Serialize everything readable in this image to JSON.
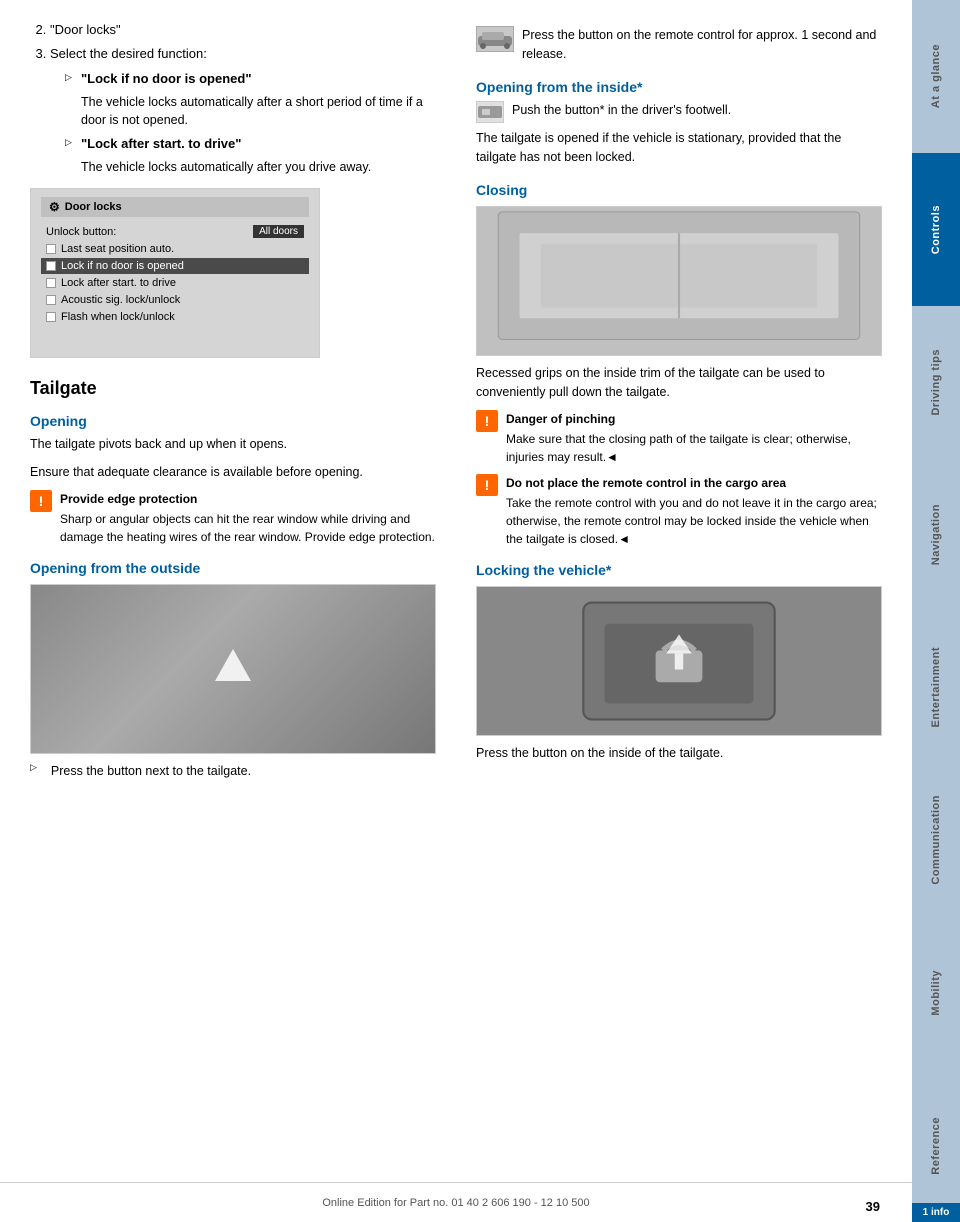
{
  "page": {
    "number": "39",
    "footer_text": "Online Edition for Part no. 01 40 2 606 190 - 12 10 500",
    "info_badge": "1 info"
  },
  "sidebar": {
    "tabs": [
      {
        "id": "at-a-glance",
        "label": "At a glance",
        "active": false
      },
      {
        "id": "controls",
        "label": "Controls",
        "active": true
      },
      {
        "id": "driving-tips",
        "label": "Driving tips",
        "active": false
      },
      {
        "id": "navigation",
        "label": "Navigation",
        "active": false
      },
      {
        "id": "entertainment",
        "label": "Entertainment",
        "active": false
      },
      {
        "id": "communication",
        "label": "Communication",
        "active": false
      },
      {
        "id": "mobility",
        "label": "Mobility",
        "active": false
      },
      {
        "id": "reference",
        "label": "Reference",
        "active": false
      }
    ]
  },
  "left_column": {
    "list_items": [
      {
        "number": "2",
        "text": "\"Door locks\""
      },
      {
        "number": "3",
        "text": "Select the desired function:",
        "subitems": [
          {
            "label": "\"Lock if no door is opened\"",
            "detail": "The vehicle locks automatically after a short period of time if a door is not opened."
          },
          {
            "label": "\"Lock after start. to drive\"",
            "detail": "The vehicle locks automatically after you drive away."
          }
        ]
      }
    ],
    "door_locks_ui": {
      "title": "Door locks",
      "unlock_label": "Unlock button:",
      "unlock_value": "All doors",
      "rows": [
        {
          "type": "checkbox",
          "label": "Last seat position auto.",
          "checked": false,
          "highlighted": false
        },
        {
          "type": "checkbox",
          "label": "Lock if no door is opened",
          "checked": false,
          "highlighted": true
        },
        {
          "type": "checkbox",
          "label": "Lock after start. to drive",
          "checked": false,
          "highlighted": false
        },
        {
          "type": "checkbox",
          "label": "Acoustic sig. lock/unlock",
          "checked": false,
          "highlighted": false
        },
        {
          "type": "checkbox",
          "label": "Flash when lock/unlock",
          "checked": false,
          "highlighted": false
        }
      ]
    },
    "tailgate_section": {
      "heading": "Tailgate",
      "opening_heading": "Opening",
      "opening_text1": "The tailgate pivots back and up when it opens.",
      "opening_text2": "Ensure that adequate clearance is available before opening.",
      "warning1": {
        "title": "Provide edge protection",
        "text": "Sharp or angular objects can hit the rear window while driving and damage the heating wires of the rear window. Provide edge protection."
      },
      "opening_from_outside_heading": "Opening from the outside",
      "press_button_text": "Press the button next to the tailgate."
    }
  },
  "right_column": {
    "remote_note": {
      "text": "Press the button on the remote control for approx. 1 second and release."
    },
    "opening_from_inside": {
      "heading": "Opening from the inside*",
      "text": "Push the button* in the driver's footwell."
    },
    "tailgate_stationary_text": "The tailgate is opened if the vehicle is stationary, provided that the tailgate has not been locked.",
    "closing_section": {
      "heading": "Closing",
      "text": "Recessed grips on the inside trim of the tailgate can be used to conveniently pull down the tailgate.",
      "warning1": {
        "title": "Danger of pinching",
        "text": "Make sure that the closing path of the tailgate is clear; otherwise, injuries may result.◄"
      },
      "warning2": {
        "title": "Do not place the remote control in the cargo area",
        "text": "Take the remote control with you and do not leave it in the cargo area; otherwise, the remote control may be locked inside the vehicle when the tailgate is closed.◄"
      }
    },
    "locking_section": {
      "heading": "Locking the vehicle*",
      "text": "Press the button on the inside of the tailgate."
    }
  }
}
